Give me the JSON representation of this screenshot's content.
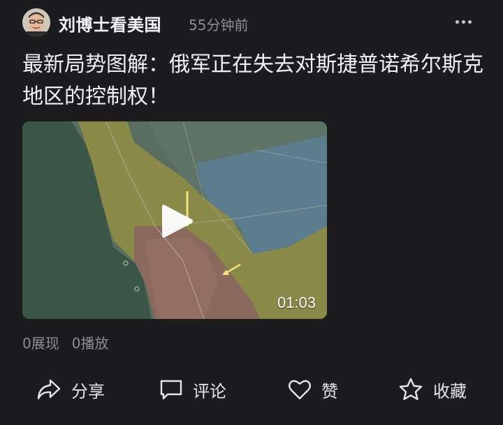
{
  "post": {
    "author": "刘博士看美国",
    "timestamp": "55分钟前",
    "title": "最新局势图解：俄军正在失去对斯捷普诺希尔斯克地区的控制权！"
  },
  "video": {
    "duration": "01:03"
  },
  "stats": {
    "views": "0展现",
    "plays": "0播放"
  },
  "actions": {
    "share": "分享",
    "comment": "评论",
    "like": "赞",
    "favorite": "收藏"
  },
  "icons": {
    "more": "more-dots-icon",
    "play": "play-icon",
    "share": "share-arrow-icon",
    "comment": "comment-bubble-icon",
    "like": "heart-icon",
    "favorite": "star-icon"
  },
  "colors": {
    "background": "#1c1c1e",
    "text": "#e8e8ea",
    "secondary": "#8e8e93"
  }
}
